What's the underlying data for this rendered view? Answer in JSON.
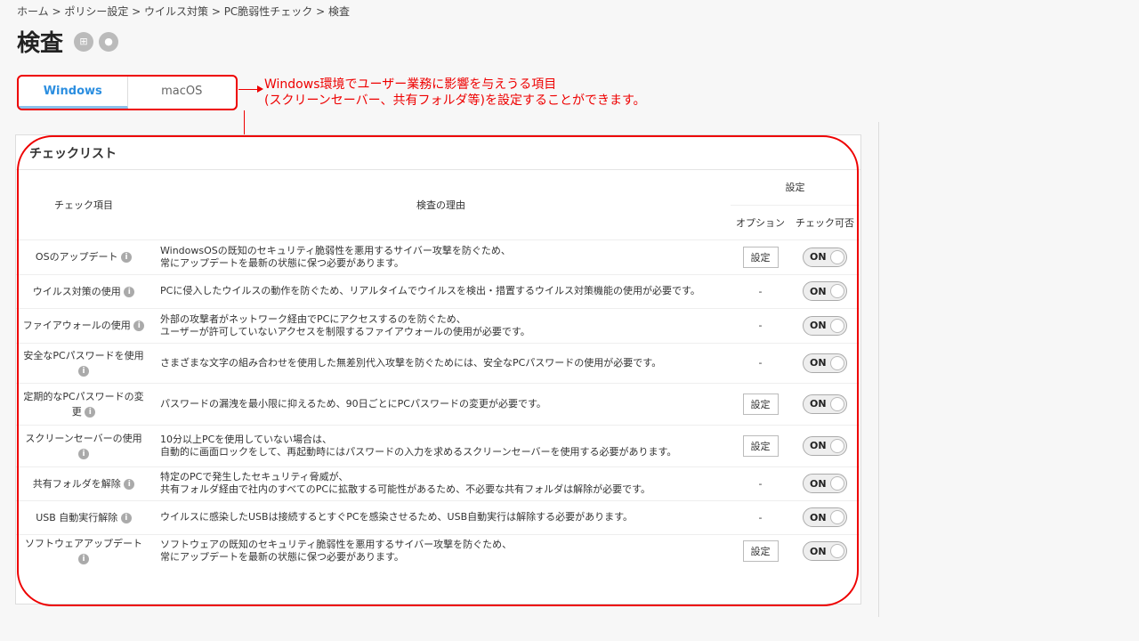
{
  "breadcrumb": "ホーム > ポリシー設定 > ウイルス対策 > PC脆弱性チェック > 検査",
  "title": "検査",
  "os_icons": [
    "windows-icon",
    "apple-icon"
  ],
  "tabs": [
    {
      "label": "Windows",
      "active": true
    },
    {
      "label": "macOS",
      "active": false
    }
  ],
  "annotation": {
    "line1": "Windows環境でユーザー業務に影響を与えうる項目",
    "line2": "(スクリーンセーバー、共有フォルダ等)を設定することができます。",
    "color": "#e00000"
  },
  "card": {
    "title": "チェックリスト",
    "headers": {
      "item": "チェック項目",
      "reason": "検査の理由",
      "settings": "設定",
      "option": "オプション",
      "check": "チェック可否"
    },
    "rows": [
      {
        "item": "OSのアップデート",
        "reason": [
          "WindowsOSの既知のセキュリティ脆弱性を悪用するサイバー攻撃を防ぐため、",
          "常にアップデートを最新の状態に保つ必要があります。"
        ],
        "option": "設定",
        "toggle": "ON"
      },
      {
        "item": "ウイルス対策の使用",
        "reason": [
          "PCに侵入したウイルスの動作を防ぐため、リアルタイムでウイルスを検出・措置するウイルス対策機能の使用が必要です。"
        ],
        "option": "-",
        "toggle": "ON"
      },
      {
        "item": "ファイアウォールの使用",
        "reason": [
          "外部の攻撃者がネットワーク経由でPCにアクセスするのを防ぐため、",
          "ユーザーが許可していないアクセスを制限するファイアウォールの使用が必要です。"
        ],
        "option": "-",
        "toggle": "ON"
      },
      {
        "item": "安全なPCパスワードを使用",
        "reason": [
          "さまざまな文字の組み合わせを使用した無差別代入攻撃を防ぐためには、安全なPCパスワードの使用が必要です。"
        ],
        "option": "-",
        "toggle": "ON"
      },
      {
        "item": "定期的なPCパスワードの変更",
        "reason": [
          "パスワードの漏洩を最小限に抑えるため、90日ごとにPCパスワードの変更が必要です。"
        ],
        "option": "設定",
        "toggle": "ON"
      },
      {
        "item": "スクリーンセーバーの使用",
        "reason": [
          "10分以上PCを使用していない場合は、",
          "自動的に画面ロックをして、再起動時にはパスワードの入力を求めるスクリーンセーバーを使用する必要があります。"
        ],
        "option": "設定",
        "toggle": "ON"
      },
      {
        "item": "共有フォルダを解除",
        "reason": [
          "特定のPCで発生したセキュリティ脅威が、",
          "共有フォルダ経由で社内のすべてのPCに拡散する可能性があるため、不必要な共有フォルダは解除が必要です。"
        ],
        "option": "-",
        "toggle": "ON"
      },
      {
        "item": "USB 自動実行解除",
        "reason": [
          "ウイルスに感染したUSBは接続するとすぐPCを感染させるため、USB自動実行は解除する必要があります。"
        ],
        "option": "-",
        "toggle": "ON"
      },
      {
        "item": "ソフトウェアアップデート",
        "reason": [
          "ソフトウェアの既知のセキュリティ脆弱性を悪用するサイバー攻撃を防ぐため、",
          "常にアップデートを最新の状態に保つ必要があります。"
        ],
        "option": "設定",
        "toggle": "ON"
      }
    ]
  }
}
